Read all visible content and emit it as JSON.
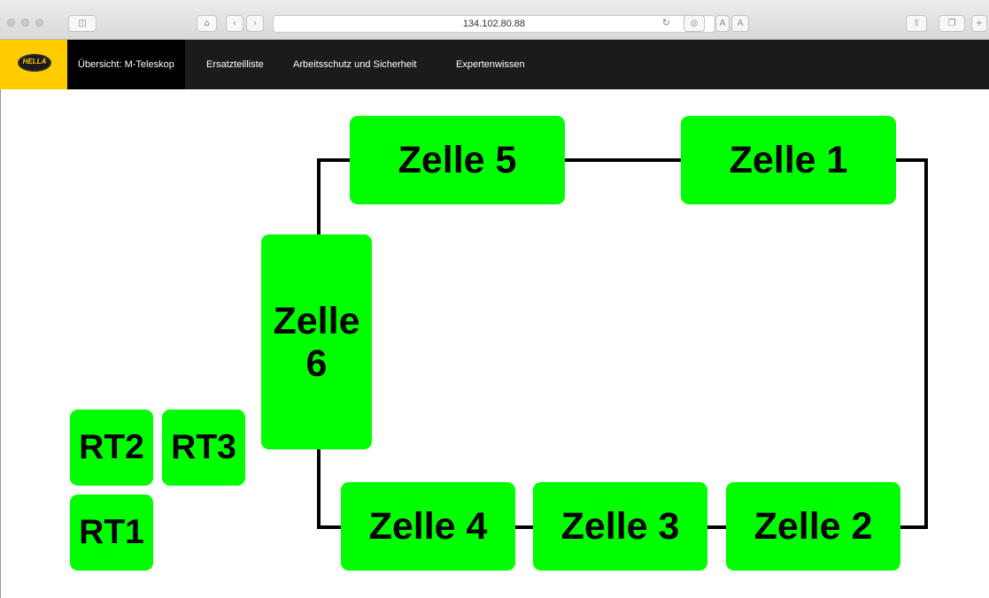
{
  "browser": {
    "url": "134.102.80.88",
    "text_size_small": "A",
    "text_size_large": "A"
  },
  "nav": {
    "logo_text": "HELLA",
    "items": [
      {
        "label": "Übersicht: M-Teleskop",
        "active": true
      },
      {
        "label": "Ersatzteilliste",
        "active": false
      },
      {
        "label": "Arbeitsschutz und Sicherheit",
        "active": false
      },
      {
        "label": "Expertenwissen",
        "active": false
      }
    ]
  },
  "colors": {
    "cell_fill": "#00ff00",
    "navbar_bg": "#1b1b1b",
    "logo_bg": "#ffcc00"
  },
  "cells": {
    "zelle5": "Zelle 5",
    "zelle1": "Zelle 1",
    "zelle6_line1": "Zelle",
    "zelle6_line2": "6",
    "zelle4": "Zelle 4",
    "zelle3": "Zelle 3",
    "zelle2": "Zelle 2",
    "rt2": "RT2",
    "rt3": "RT3",
    "rt1": "RT1"
  }
}
